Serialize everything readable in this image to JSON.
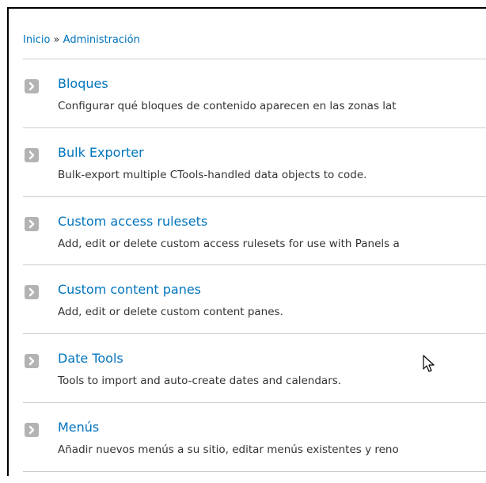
{
  "breadcrumb": {
    "home": "Inicio",
    "separator": "»",
    "current": "Administración"
  },
  "items": [
    {
      "title": "Bloques",
      "description": "Configurar qué bloques de contenido aparecen en las zonas lat"
    },
    {
      "title": "Bulk Exporter",
      "description": "Bulk-export multiple CTools-handled data objects to code."
    },
    {
      "title": "Custom access rulesets",
      "description": "Add, edit or delete custom access rulesets for use with Panels a"
    },
    {
      "title": "Custom content panes",
      "description": "Add, edit or delete custom content panes."
    },
    {
      "title": "Date Tools",
      "description": "Tools to import and auto-create dates and calendars."
    },
    {
      "title": "Menús",
      "description": "Añadir nuevos menús a su sitio, editar menús existentes y reno"
    }
  ],
  "icons": {
    "item_arrow": "chevron-right-icon",
    "cursor": "mouse-pointer-icon"
  },
  "colors": {
    "link": "#0074bd",
    "text": "#333333",
    "arrow_bg": "#b3b3b3",
    "divider": "#cccccc"
  }
}
